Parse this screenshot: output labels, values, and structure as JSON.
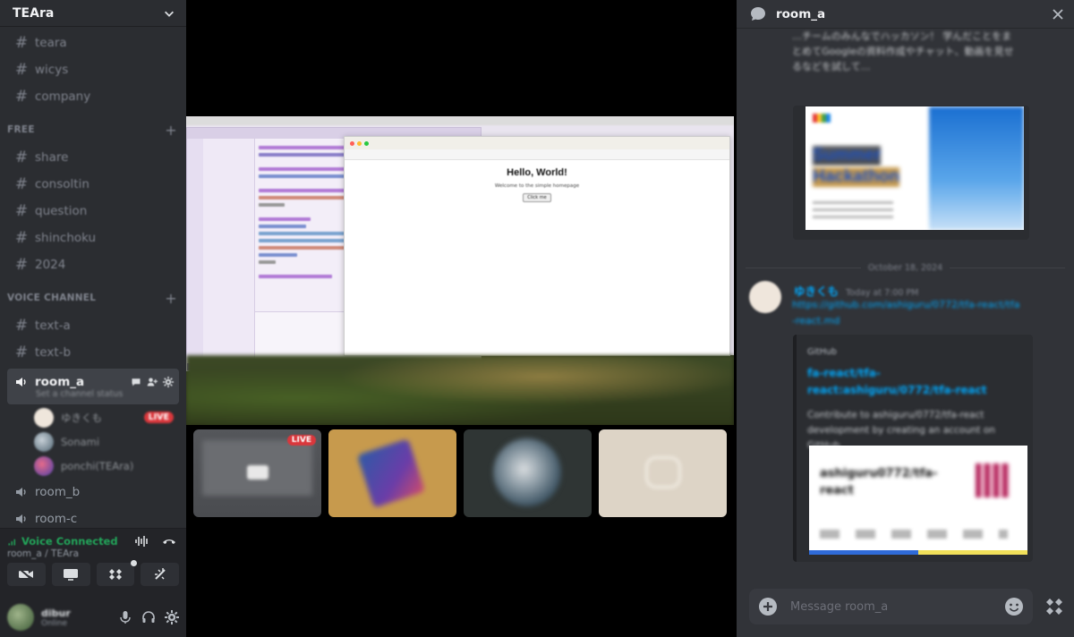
{
  "server": {
    "name": "TEAra"
  },
  "channels_top": [
    {
      "label": "teara"
    },
    {
      "label": "wicys"
    },
    {
      "label": "company"
    }
  ],
  "category_free": {
    "label": "FREE"
  },
  "channels_free": [
    {
      "label": "share"
    },
    {
      "label": "consoltin"
    },
    {
      "label": "question"
    },
    {
      "label": "shinchoku"
    },
    {
      "label": "2024"
    }
  ],
  "category_voice": {
    "label": "VOICE CHANNEL"
  },
  "voice_channels": [
    {
      "label": "text-a"
    },
    {
      "label": "text-b"
    }
  ],
  "active_voice": {
    "label": "room_a",
    "status": "Set a channel status",
    "users": [
      {
        "name": "ゆきくも",
        "live": "LIVE",
        "color": "#efe6dc"
      },
      {
        "name": "Sonami",
        "live": "",
        "color": "#7a8a99"
      },
      {
        "name": "ponchi(TEAra)",
        "live": "",
        "color": "#6d4bb0"
      }
    ]
  },
  "other_voice": [
    {
      "label": "room_b"
    },
    {
      "label": "room-c"
    }
  ],
  "voice_panel": {
    "status": "Voice Connected",
    "location": "room_a / TEAra"
  },
  "user_panel": {
    "name": "dibur",
    "tag": "Online"
  },
  "stage": {
    "browser_heading": "Hello, World!",
    "browser_desc": "Welcome to the simple homepage",
    "browser_button": "Click me",
    "thumb_live": "LIVE"
  },
  "chat": {
    "channel": "room_a",
    "intro_text": "…チームのみんなでハッカソン！ 学んだことをまとめてGoogleの資料作成やチャット、動画を見せるなどを試して…",
    "hackathon_card": {
      "line1": "Summer",
      "line2": "Hackathon"
    },
    "divider": "October 18, 2024",
    "message": {
      "user": "ゆきくも",
      "timestamp": "Today at 7:00 PM",
      "link": "https://github.com/ashiguru/0772/tfa-react/tfa-react.md"
    },
    "github_card": {
      "site": "GitHub",
      "title": "fa-react/tfa-react:ashiguru/0772/tfa-react",
      "desc": "Contribute to ashiguru/0772/tfa-react development by creating an account on GitHub.",
      "image_title": "ashiguru0772/tfa-react"
    },
    "composer_placeholder": "Message room_a"
  },
  "colors": {
    "accent": "#5865f2",
    "live": "#da373c",
    "voice_green": "#23a55a",
    "link": "#00a8fc"
  }
}
